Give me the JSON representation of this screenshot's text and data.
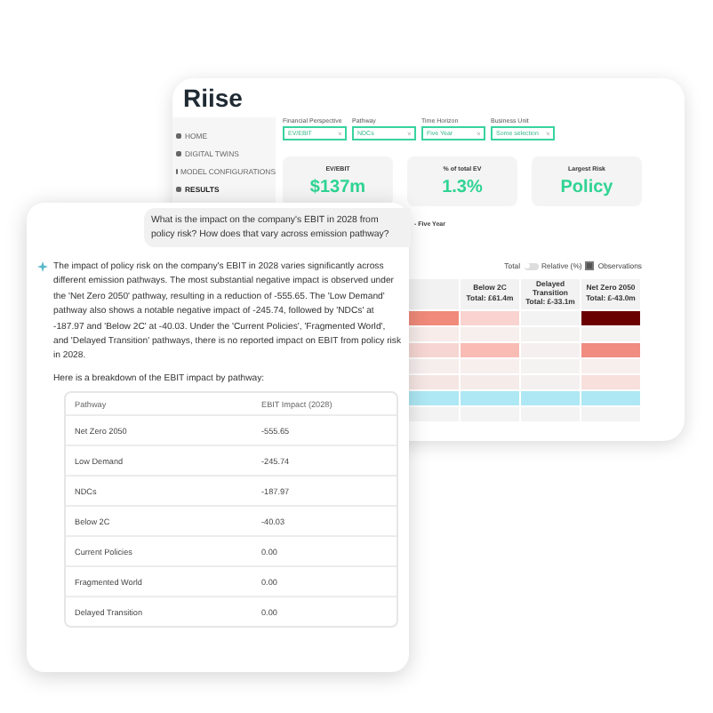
{
  "dashboard": {
    "logo": "Riise",
    "sidebar": {
      "items": [
        {
          "label": "HOME",
          "selected": false
        },
        {
          "label": "DIGITAL TWINS",
          "selected": false
        },
        {
          "label": "MODEL CONFIGURATIONS",
          "selected": false
        },
        {
          "label": "RESULTS",
          "selected": true
        }
      ]
    },
    "filters": [
      {
        "label": "Financial Perspective",
        "value": "EV/EBIT"
      },
      {
        "label": "Pathway",
        "value": "NDCs"
      },
      {
        "label": "Time Horizon",
        "value": "Five Year"
      },
      {
        "label": "Business Unit",
        "value": "Some selection"
      }
    ],
    "metrics": [
      {
        "label": "EV/EBIT",
        "value": "$137m"
      },
      {
        "label": "% of total EV",
        "value": "1.3%"
      },
      {
        "label": "Largest Risk",
        "value": "Policy"
      }
    ],
    "section_title": "- Five Year",
    "toggles": {
      "left_label": "Total",
      "toggle_on": false,
      "right_label": "Relative (%)",
      "observations_checked": true,
      "observations_label": "Observations"
    },
    "heatmap": {
      "columns": [
        {},
        {
          "title": "Below 2C",
          "total": "Total: £61.4m"
        },
        {
          "title": "Delayed Transition",
          "total": "Total: £-33.1m"
        },
        {
          "title": "Net Zero 2050",
          "total": "Total: £-43.0m"
        }
      ],
      "rows": [
        {
          "cells": [
            {
              "color": "#f08a7a"
            },
            {
              "color": "#f9d3cf"
            },
            {
              "color": "#f3f3f3"
            },
            {
              "color": "#6b0000"
            }
          ]
        },
        {
          "cells": [
            {
              "color": "#f7ecea"
            },
            {
              "color": "#f7efed"
            },
            {
              "color": "#f5f3f2"
            },
            {
              "color": "#f5f3f2"
            }
          ]
        },
        {
          "cells": [
            {
              "color": "#f6d6d2"
            },
            {
              "color": "#f9bcb4"
            },
            {
              "color": "#f5f0ef"
            },
            {
              "color": "#f08c80"
            }
          ]
        },
        {
          "cells": [
            {
              "color": "#f6eeec"
            },
            {
              "color": "#f7efed"
            },
            {
              "color": "#f5f3f2"
            },
            {
              "color": "#f7efed"
            }
          ]
        },
        {
          "cells": [
            {
              "color": "#f6e6e3"
            },
            {
              "color": "#f5ebe9"
            },
            {
              "color": "#f3f0ef"
            },
            {
              "color": "#f8e0dc"
            }
          ]
        },
        {
          "cells": [
            {
              "color": "#ade8f4"
            },
            {
              "color": "#ade8f4"
            },
            {
              "color": "#ade8f4"
            },
            {
              "color": "#ade8f4"
            }
          ]
        },
        {
          "cells": [
            {
              "color": "#f3f3f3"
            },
            {
              "color": "#f3f3f3"
            },
            {
              "color": "#f3f3f3"
            },
            {
              "color": "#f3f3f3"
            }
          ]
        }
      ]
    }
  },
  "chat": {
    "question": "What is the impact on the company's EBIT in 2028 from policy risk? How does that vary across emission pathway?",
    "answer": "The impact of policy risk on the company's EBIT in 2028 varies significantly across different emission pathways. The most substantial negative impact is observed under the 'Net Zero 2050' pathway, resulting in a reduction of -555.65. The 'Low Demand' pathway also shows a notable negative impact of -245.74, followed by 'NDCs' at -187.97 and 'Below 2C' at -40.03. Under the 'Current Policies', 'Fragmented World', and 'Delayed Transition' pathways, there is no reported impact on EBIT from policy risk in 2028.",
    "intro": "Here is a breakdown of the EBIT impact by pathway:",
    "table": {
      "columns": [
        "Pathway",
        "EBIT Impact (2028)"
      ],
      "rows": [
        [
          "Net Zero 2050",
          "-555.65"
        ],
        [
          "Low Demand",
          "-245.74"
        ],
        [
          "NDCs",
          "-187.97"
        ],
        [
          "Below 2C",
          "-40.03"
        ],
        [
          "Current Policies",
          "0.00"
        ],
        [
          "Fragmented World",
          "0.00"
        ],
        [
          "Delayed Transition",
          "0.00"
        ]
      ]
    }
  }
}
